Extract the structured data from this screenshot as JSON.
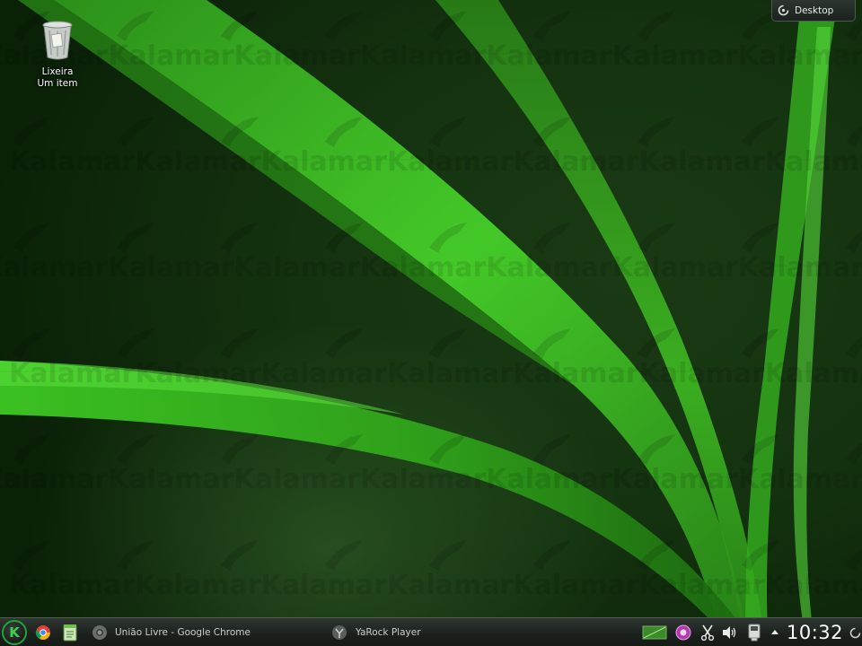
{
  "desktop": {
    "watermark": "Kalamar",
    "trash": {
      "name": "Lixeira",
      "subtitle": "Um item"
    },
    "toolbox_label": "Desktop"
  },
  "panel": {
    "tasks": [
      {
        "title": "União Livre - Google Chrome",
        "icon": "chrome-icon"
      },
      {
        "title": "YaRock Player",
        "icon": "yarock-icon"
      }
    ],
    "clock": "10:32"
  },
  "colors": {
    "wallpaper_dark": "#0f2b0b",
    "leaf_green": "#3dd423",
    "launcher_accent": "#1fa33a"
  }
}
